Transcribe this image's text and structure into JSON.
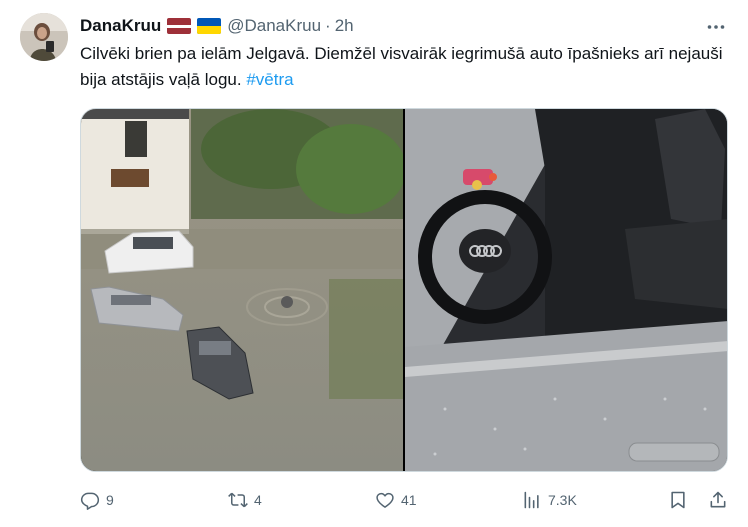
{
  "author": {
    "display_name": "DanaKruu",
    "handle": "@DanaKruu",
    "separator": "·",
    "time": "2h",
    "flags": [
      "latvia-flag",
      "ukraine-flag"
    ]
  },
  "tweet": {
    "text": "Cilvēki brien pa ielām Jelgavā. Diemžēl visvairāk iegrimušā auto īpašnieks arī nejauši bija atstājis vaļā logu. ",
    "hashtag": "#vētra"
  },
  "actions": {
    "replies": "9",
    "reposts": "4",
    "likes": "41",
    "views": "7.3K"
  },
  "colors": {
    "text": "#0f1419",
    "secondary": "#536471",
    "link": "#1d9bf0",
    "border": "#cfd9de"
  },
  "icons": [
    "more-icon",
    "reply-icon",
    "repost-icon",
    "like-icon",
    "views-icon",
    "bookmark-icon",
    "share-icon"
  ]
}
